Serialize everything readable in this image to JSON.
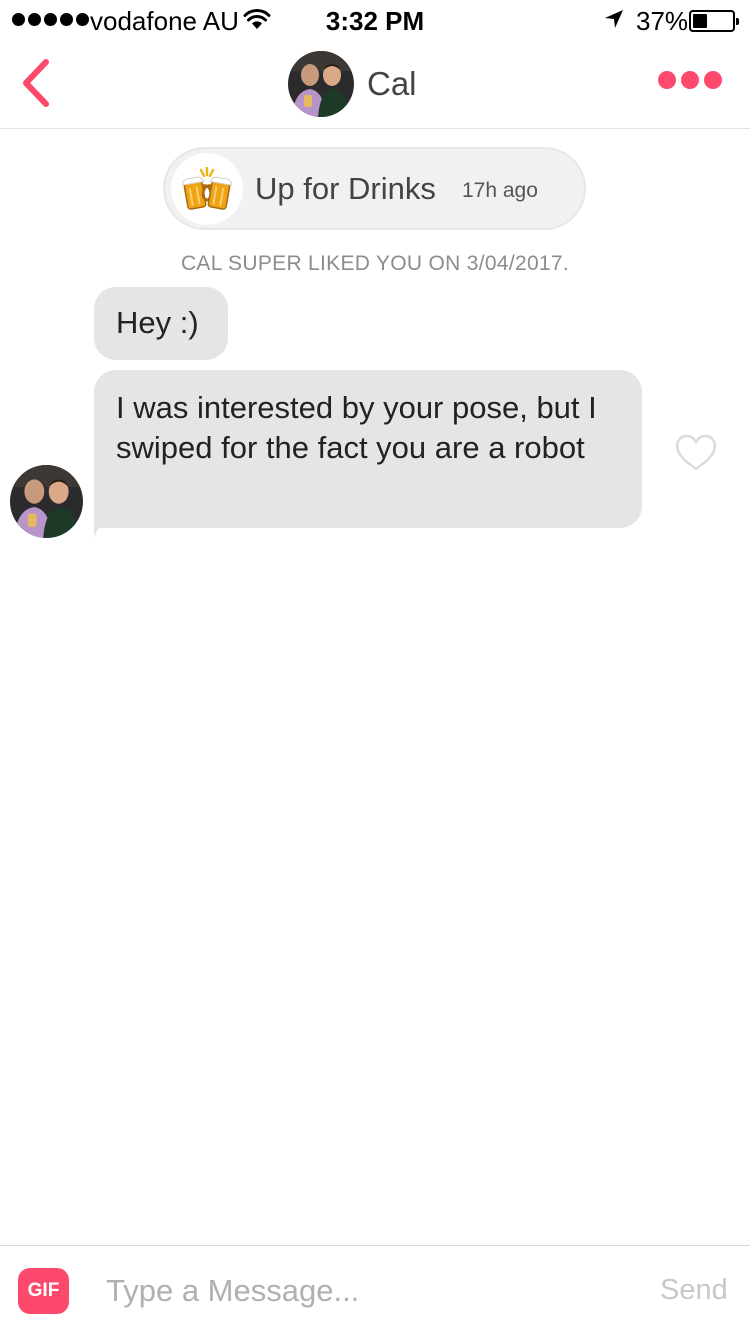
{
  "status_bar": {
    "carrier": "vodafone AU",
    "time": "3:32 PM",
    "battery_percent": "37%",
    "battery_level": 0.37
  },
  "nav": {
    "match_name": "Cal"
  },
  "status_card": {
    "emoji": "beer-mugs",
    "text": "Up for Drinks",
    "time_ago": "17h ago"
  },
  "super_like_notice": "CAL SUPER LIKED YOU ON 3/04/2017.",
  "messages": [
    {
      "text": "Hey :)"
    },
    {
      "text": "I was interested by your pose, but I swiped for the fact you are a robot"
    }
  ],
  "composer": {
    "gif_label": "GIF",
    "placeholder": "Type a Message...",
    "send_label": "Send"
  },
  "colors": {
    "accent": "#fd4a6c",
    "bubble": "#e5e5e5"
  }
}
